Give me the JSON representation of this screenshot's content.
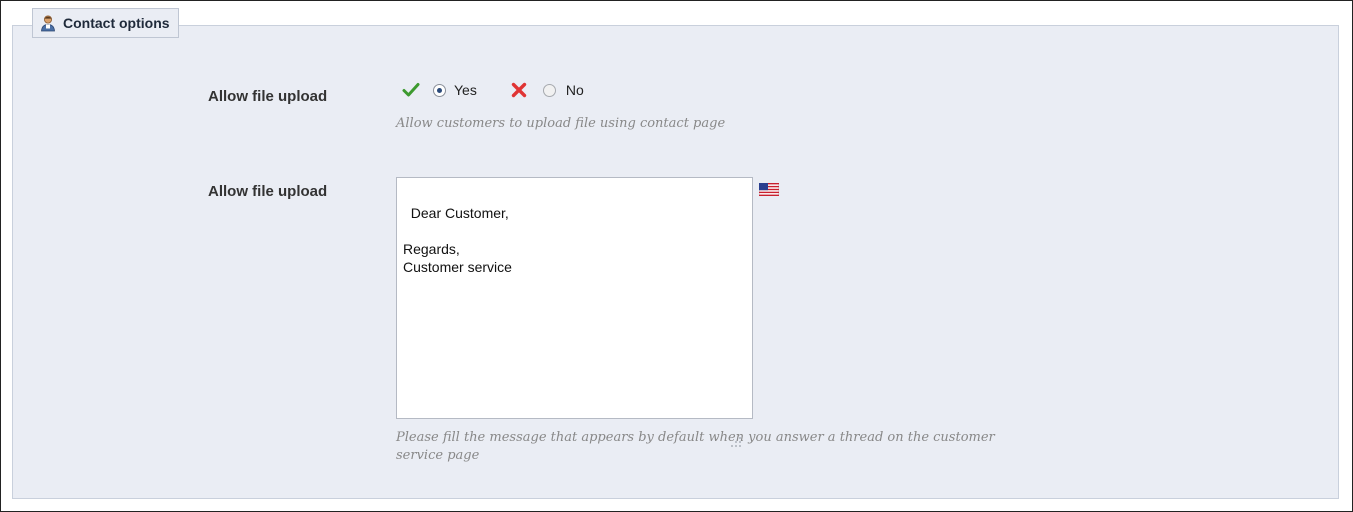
{
  "section": {
    "title": "Contact options",
    "icon": "customer-service-icon"
  },
  "file_upload": {
    "label": "Allow file upload",
    "yes_label": "Yes",
    "no_label": "No",
    "selected": "Yes",
    "hint": "Allow customers to upload file using contact page"
  },
  "default_message": {
    "label": "Allow file upload",
    "value": "Dear Customer,\n\nRegards,\nCustomer service",
    "language_icon": "us-flag-icon",
    "hint_line1": "Please fill the message that appears by default when you answer a thread on the customer",
    "hint_line2": "service page"
  },
  "colors": {
    "panel_bg": "#eaedf4",
    "check_green": "#3d9a2f",
    "x_red": "#e03434"
  }
}
